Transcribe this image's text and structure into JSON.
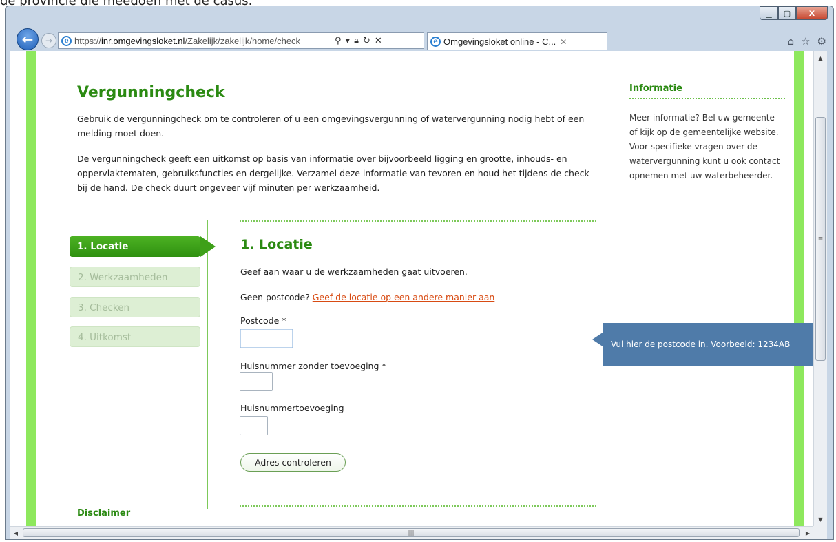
{
  "caption": "de provincie die meedoen met de casus.",
  "browser": {
    "address": {
      "protocol": "https://",
      "host": "inr.omgevingsloket.nl",
      "path": "/Zakelijk/zakelijk/home/check"
    },
    "tab_title": "Omgevingsloket online - C...",
    "window_controls": {
      "close": "x"
    }
  },
  "page": {
    "title": "Vergunningcheck",
    "intro1": "Gebruik de vergunningcheck om te controleren of u een omgevingsvergunning of watervergunning nodig hebt of een melding moet doen.",
    "intro2": "De vergunningcheck geeft een uitkomst op basis van informatie over bijvoorbeeld ligging en grootte, inhouds- en oppervlaktematen, gebruiksfuncties en dergelijke. Verzamel deze informatie van tevoren en houd het tijdens de check bij de hand. De check duurt ongeveer vijf minuten per werkzaamheid.",
    "sidebar": {
      "heading": "Informatie",
      "text": "Meer informatie? Bel uw gemeente of kijk op de gemeentelijke website. Voor specifieke vragen over de watervergunning kunt u ook contact opnemen met uw waterbeheerder."
    },
    "steps": [
      {
        "label": "1. Locatie",
        "state": "active"
      },
      {
        "label": "2. Werkzaamheden",
        "state": "inactive"
      },
      {
        "label": "3. Checken",
        "state": "inactive"
      },
      {
        "label": "4. Uitkomst",
        "state": "inactive"
      }
    ],
    "section": {
      "heading": "1. Locatie",
      "instruction": "Geef aan waar u de werkzaamheden gaat uitvoeren.",
      "no_postcode_prefix": "Geen postcode?",
      "no_postcode_link": "Geef de locatie op een andere manier aan",
      "fields": {
        "postcode_label": "Postcode *",
        "postcode_value": "",
        "huisnummer_label": "Huisnummer zonder toevoeging *",
        "huisnummer_value": "",
        "toevoeging_label": "Huisnummertoevoeging",
        "toevoeging_value": ""
      },
      "button": "Adres controleren",
      "tooltip": "Vul hier de postcode in. Voorbeeld: 1234AB"
    },
    "footer_heading": "Disclaimer"
  },
  "colors": {
    "brand_green": "#2b8a12",
    "rail_green": "#8ee85d",
    "link_orange": "#d84b13",
    "tooltip_blue": "#4f7ba9"
  }
}
